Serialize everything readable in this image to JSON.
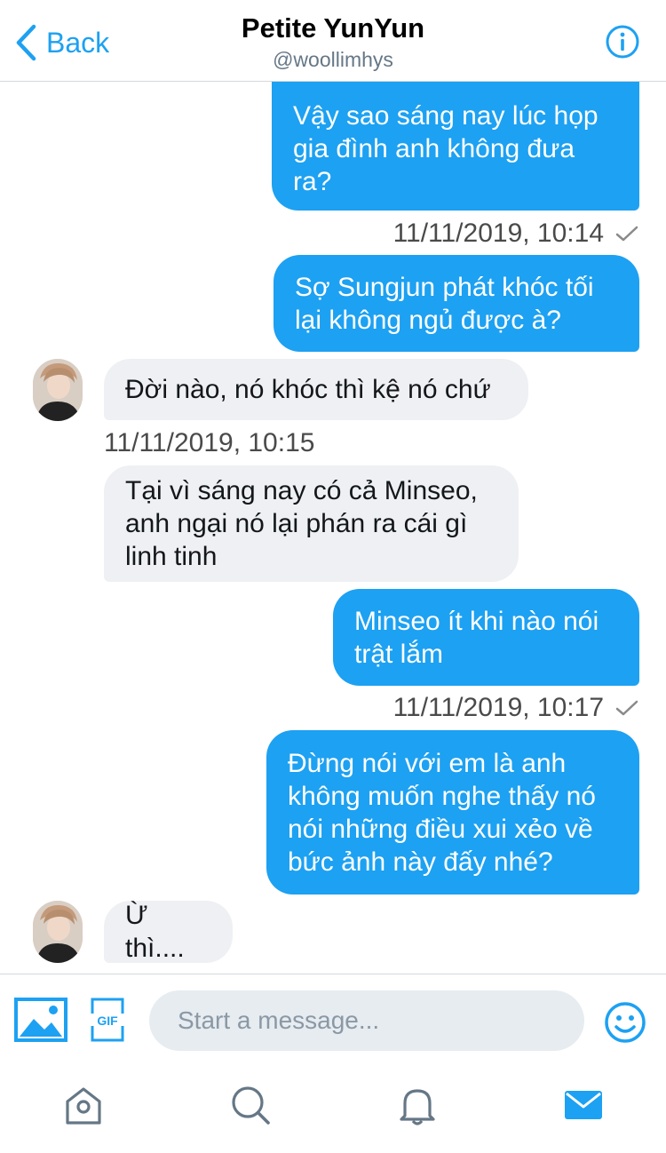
{
  "header": {
    "back_label": "Back",
    "title": "Petite YunYun",
    "handle": "@woollimhys"
  },
  "messages": [
    {
      "from": "me",
      "text": "Vậy sao sáng nay lúc họp\ngia đình anh không đưa\nra?"
    },
    {
      "timestamp": "11/11/2019, 10:14",
      "status": "read"
    },
    {
      "from": "me",
      "text": "Sợ Sungjun phát khóc tối\nlại không ngủ được à?"
    },
    {
      "from": "them",
      "text": "Đời nào, nó khóc thì kệ nó chứ"
    },
    {
      "timestamp": "11/11/2019, 10:15"
    },
    {
      "from": "them",
      "text": "Tại vì sáng nay có cả Minseo,\nanh ngại nó lại phán ra cái gì\nlinh tinh"
    },
    {
      "from": "me",
      "text": "Minseo ít khi nào nói\ntrật lắm"
    },
    {
      "timestamp": "11/11/2019, 10:17",
      "status": "read"
    },
    {
      "from": "me",
      "text": "Đừng nói với em là anh\nkhông muốn nghe thấy nó\nnói những điều xui xẻo về\nbức ảnh này đấy nhé?"
    },
    {
      "from": "them",
      "text": "Ừ thì...."
    }
  ],
  "composer": {
    "placeholder": "Start a message...",
    "gif_label": "GIF"
  },
  "colors": {
    "accent": "#1da1f2",
    "incoming_bubble": "#eef0f3",
    "timestamp_text": "#4a4a4a",
    "handle_text": "#657786"
  },
  "icons": {
    "back": "chevron-left-icon",
    "info": "info-icon",
    "photo": "photo-icon",
    "gif": "gif-icon",
    "emoji": "emoji-icon",
    "home": "home-icon",
    "search": "search-icon",
    "notifications": "bell-icon",
    "messages": "envelope-icon"
  }
}
